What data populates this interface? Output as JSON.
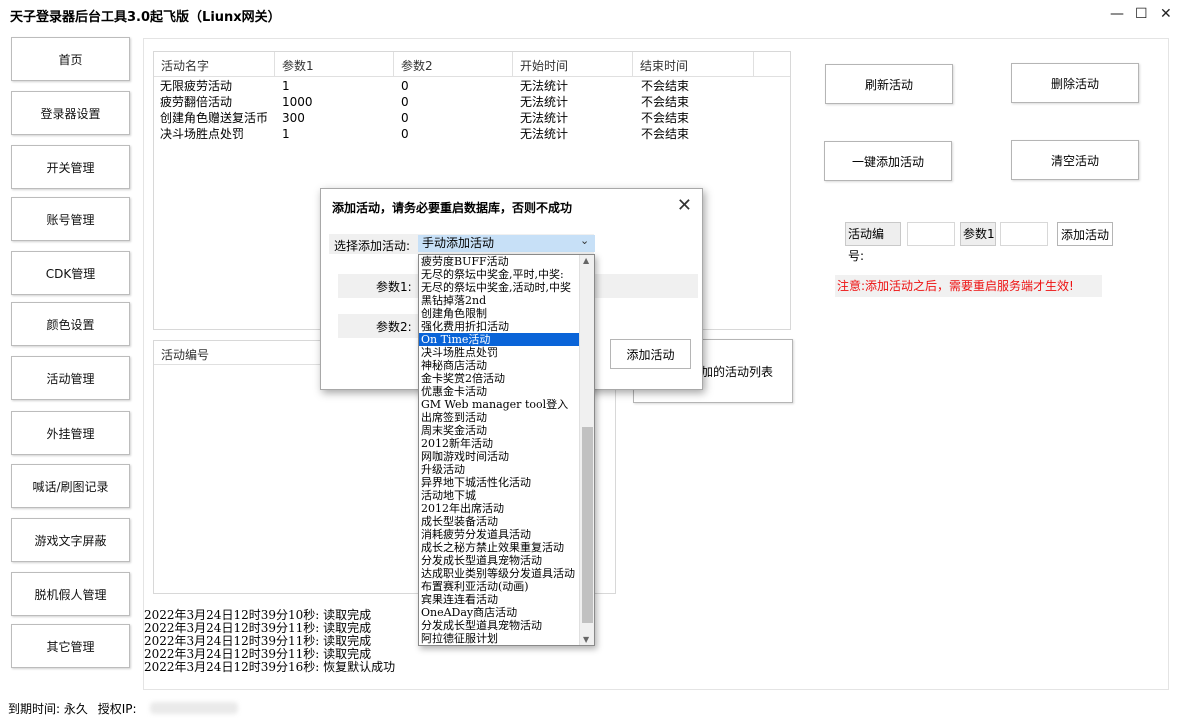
{
  "window": {
    "title": "天子登录器后台工具3.0起飞版（Liunx网关）",
    "controls": {
      "minimize": "—",
      "maximize": "☐",
      "close": "✕"
    }
  },
  "nav": [
    {
      "label": "首页"
    },
    {
      "label": "登录器设置"
    },
    {
      "label": "开关管理"
    },
    {
      "label": "账号管理"
    },
    {
      "label": "CDK管理"
    },
    {
      "label": "颜色设置"
    },
    {
      "label": "活动管理"
    },
    {
      "label": "外挂管理"
    },
    {
      "label": "喊话/刷图记录"
    },
    {
      "label": "游戏文字屏蔽"
    },
    {
      "label": "脱机假人管理"
    },
    {
      "label": "其它管理"
    }
  ],
  "active_table": {
    "headers": [
      "活动名字",
      "参数1",
      "参数2",
      "开始时间",
      "结束时间"
    ],
    "rows": [
      [
        "无限疲劳活动",
        "1",
        "0",
        "无法统计",
        "不会结束"
      ],
      [
        "疲劳翻倍活动",
        "1000",
        "0",
        "无法统计",
        "不会结束"
      ],
      [
        "创建角色赠送复活币",
        "300",
        "0",
        "无法统计",
        "不会结束"
      ],
      [
        "决斗场胜点处罚",
        "1",
        "0",
        "无法统计",
        "不会结束"
      ]
    ]
  },
  "id_table": {
    "header": "活动编号"
  },
  "list_button_partial": "加的活动列表",
  "buttons": {
    "refresh": "刷新活动",
    "delete": "删除活动",
    "one_click_add": "一键添加活动",
    "clear": "清空活动",
    "add": "添加活动"
  },
  "quick_add": {
    "id_label": "活动编号:",
    "param1_label": "参数1"
  },
  "warning": "注意:添加活动之后，需要重启服务端才生效!",
  "log": [
    "2022年3月24日12时39分10秒: 读取完成",
    "2022年3月24日12时39分11秒: 读取完成",
    "2022年3月24日12时39分11秒: 读取完成",
    "2022年3月24日12时39分11秒: 读取完成",
    "2022年3月24日12时39分16秒: 恢复默认成功"
  ],
  "status": {
    "expire": "到期时间: 永久",
    "auth_ip": "授权IP:"
  },
  "dialog": {
    "title": "添加活动，请务必要重启数据库，否则不成功",
    "select_label": "选择添加活动:",
    "selected": "手动添加活动",
    "param1_label": "参数1:",
    "param2_label": "参数2:",
    "add_button": "添加活动"
  },
  "dropdown": {
    "items": [
      "疲劳度BUFF活动",
      "无尽的祭坛中奖金,平时,中奖:",
      "无尽的祭坛中奖金,活动时,中奖",
      "黑钻掉落2nd",
      "创建角色限制",
      "强化费用折扣活动",
      "On Time活动",
      "决斗场胜点处罚",
      "神秘商店活动",
      "金卡奖赏2倍活动",
      "优惠金卡活动",
      "GM Web manager tool登入",
      "出席签到活动",
      "周末奖金活动",
      "2012新年活动",
      "网咖游戏时间活动",
      "升级活动",
      "异界地下城活性化活动",
      "活动地下城",
      "2012年出席活动",
      "成长型装备活动",
      "消耗疲劳分发道具活动",
      "成长之秘方禁止效果重复活动",
      "分发成长型道具宠物活动",
      "达成职业类别等级分发道具活动",
      "布置赛利亚活动(动画)",
      "宾果连连看活动",
      "OneADay商店活动",
      "分发成长型道具宠物活动",
      "阿拉德征服计划"
    ],
    "selected_index": 6
  }
}
